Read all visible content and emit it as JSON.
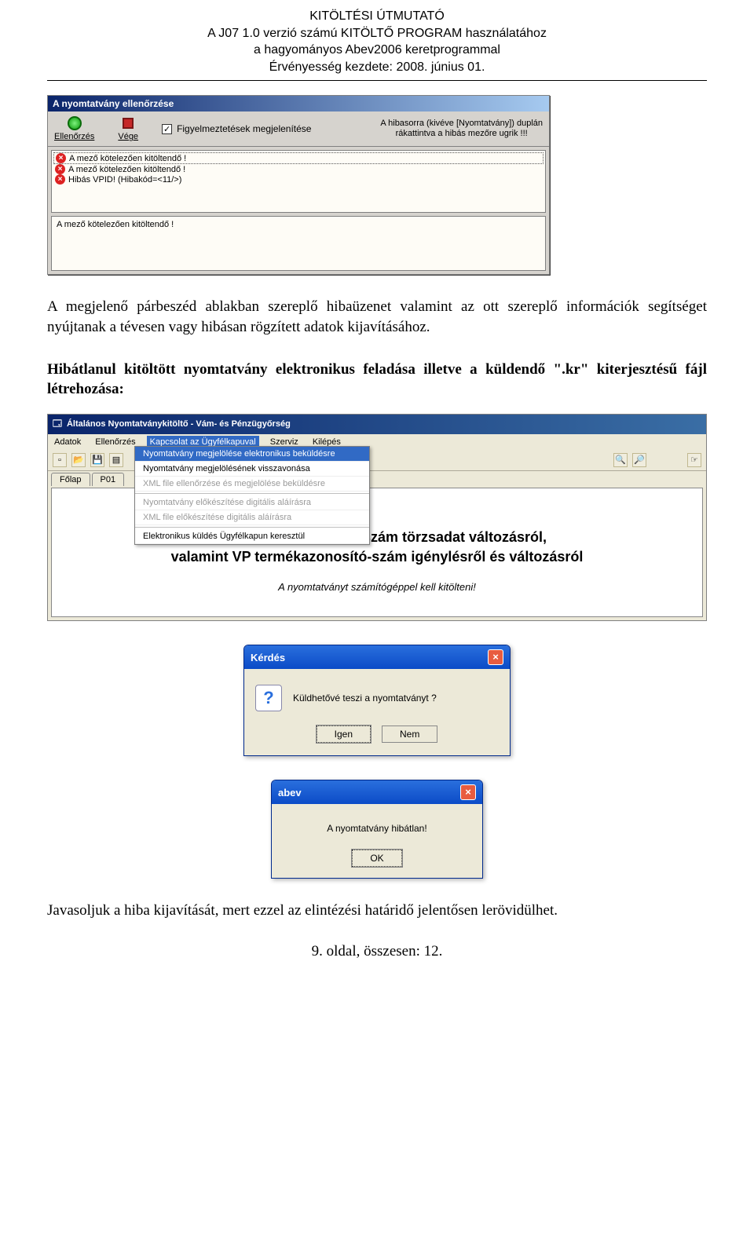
{
  "doc_header": {
    "l1": "KITÖLTÉSI ÚTMUTATÓ",
    "l2": "A J07 1.0 verzió számú KITÖLTŐ PROGRAM használatához",
    "l3": "a hagyományos Abev2006 keretprogrammal",
    "l4": "Érvényesség kezdete: 2008. június 01."
  },
  "errwin": {
    "title": "A nyomtatvány ellenőrzése",
    "btn_check": "Ellenőrzés",
    "btn_end": "Vége",
    "chk_label": "Figyelmeztetések megjelenítése",
    "hint1": "A hibasorra (kivéve [Nyomtatvány]) duplán",
    "hint2": "rákattintva a hibás  mezőre ugrik !!!",
    "errors": [
      "A mező kötelezően kitöltendő !",
      "A mező kötelezően kitöltendő !",
      "Hibás VPID! (Hibakód=<11/>)"
    ],
    "msg": "A mező kötelezően kitöltendő !"
  },
  "para1": "A megjelenő párbeszéd ablakban szereplő hibaüzenet valamint az ott szereplő információk segítséget nyújtanak a tévesen vagy hibásan rögzített adatok kijavításához.",
  "para2": "Hibátlanul kitöltött nyomtatvány elektronikus feladása illetve a küldendő \".kr\" kiterjesztésű fájl létrehozása:",
  "app": {
    "title": "Általános Nyomtatványkitöltő - Vám- és Pénzügyőrség",
    "menus": [
      "Adatok",
      "Ellenőrzés",
      "Kapcsolat az Ügyfélkapuval",
      "Szerviz",
      "Kilépés"
    ],
    "selected_menu": "Kapcsolat az Ügyfélkapuval",
    "dropdown": [
      {
        "label": "Nyomtatvány megjelölése elektronikus beküldésre",
        "hi": true
      },
      {
        "label": "Nyomtatvány megjelölésének visszavonása"
      },
      {
        "label": "XML file ellenőrzése és megjelölése beküldésre",
        "dis": true
      },
      {
        "label": "Nyomtatvány előkészítése digitális aláírásra",
        "dis": true
      },
      {
        "label": "XML file előkészítése digitális aláírásra",
        "dis": true
      },
      {
        "label": "Elektronikus küldés Ügyfélkapun keresztül"
      }
    ],
    "tabs": [
      "Főlap",
      "P01"
    ],
    "form_head1": "Bejelentés EAN (GTIN) szám törzsadat változásról,",
    "form_head2": "valamint VP termékazonosító-szám igénylésről és változásról",
    "form_sub": "A nyomtatványt számítógéppel kell kitölteni!"
  },
  "kerdes": {
    "title": "Kérdés",
    "text": "Küldhetővé teszi a nyomtatványt ?",
    "yes": "Igen",
    "no": "Nem"
  },
  "abev": {
    "title": "abev",
    "text": "A nyomtatvány hibátlan!",
    "ok": "OK"
  },
  "footer": "Javasoljuk a hiba kijavítását, mert ezzel az elintézési határidő jelentősen lerövidülhet.",
  "page": "9. oldal, összesen: 12."
}
